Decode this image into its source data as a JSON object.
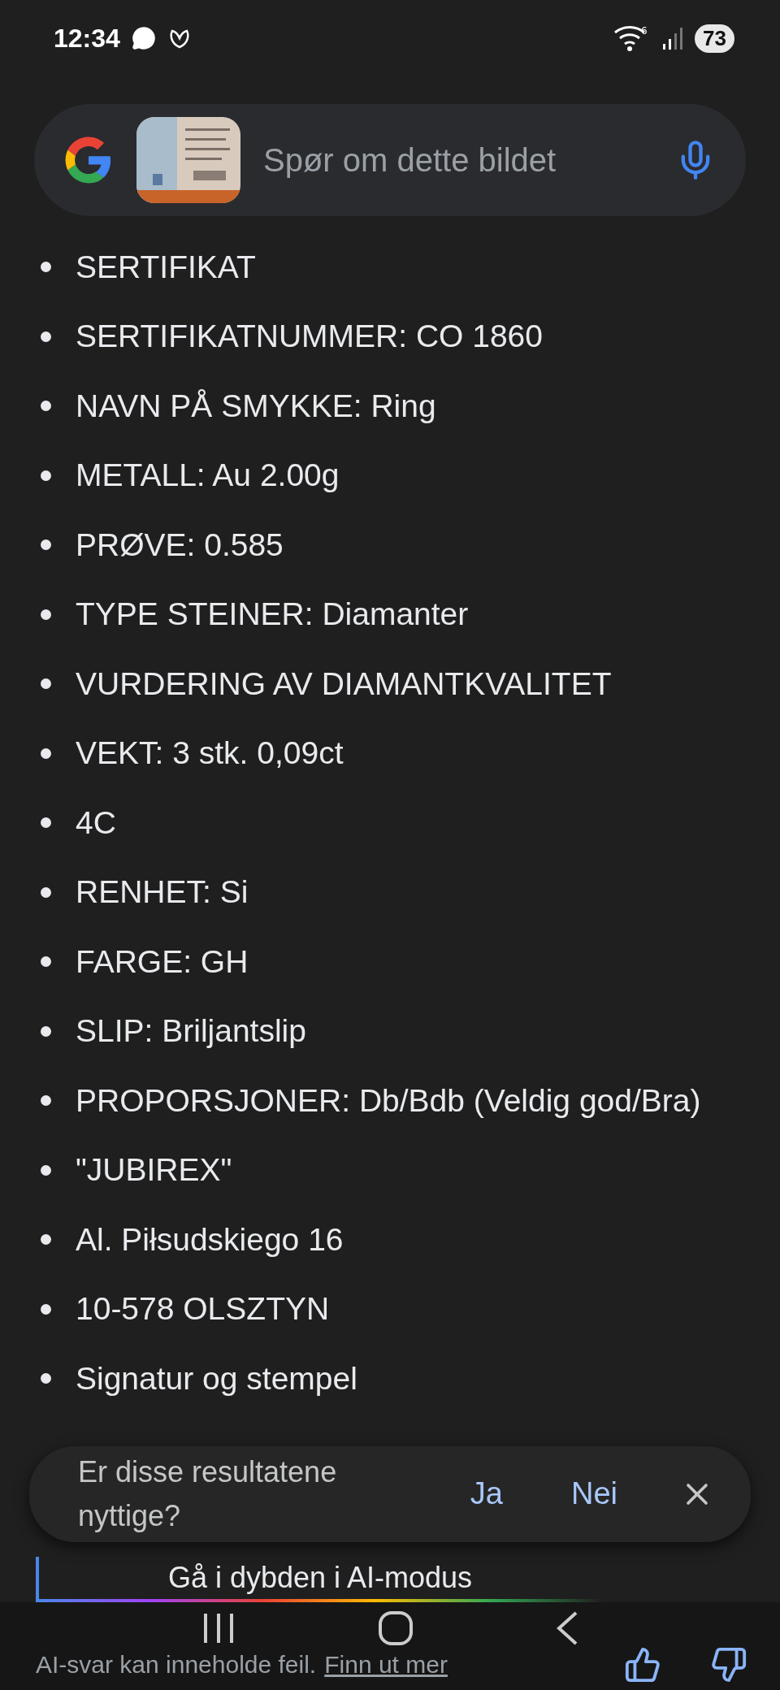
{
  "status_bar": {
    "time": "12:34",
    "battery": "73",
    "wifi_badge": "6"
  },
  "search": {
    "placeholder": "Spør om dette bildet"
  },
  "items": [
    "SERTIFIKAT",
    "SERTIFIKATNUMMER: CO 1860",
    "NAVN PÅ SMYKKE: Ring",
    "METALL: Au 2.00g",
    "PRØVE: 0.585",
    "TYPE STEINER: Diamanter",
    "VURDERING AV DIAMANTKVALITET",
    "VEKT: 3 stk. 0,09ct",
    "4C",
    "RENHET: Si",
    "FARGE: GH",
    "SLIP: Briljantslip",
    "PROPORSJONER: Db/Bdb (Veldig god/Bra)",
    "\"JUBIREX\"",
    "Al. Piłsudskiego 16",
    "10-578 OLSZTYN",
    "Signatur og stempel"
  ],
  "feedback": {
    "question": "Er disse resultatene nyttige?",
    "yes": "Ja",
    "no": "Nei"
  },
  "ai_mode_button": "Gå i dybden i AI-modus",
  "footer": {
    "disclaimer": "AI-svar kan inneholde feil.",
    "link": "Finn ut mer"
  }
}
